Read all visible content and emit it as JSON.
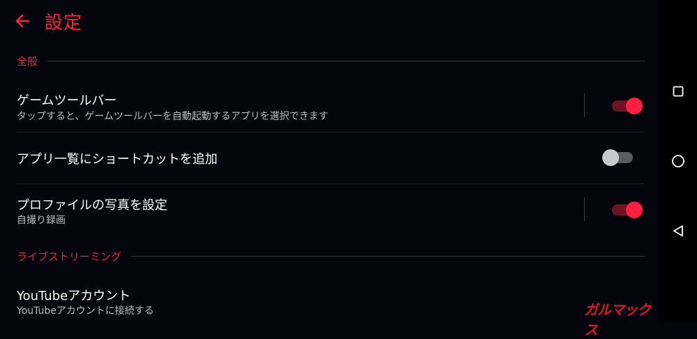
{
  "appbar": {
    "title": "設定",
    "back_icon": "arrow-left-icon"
  },
  "accent_color": "#ff1e3c",
  "sections": {
    "general": {
      "label": "全般"
    },
    "live": {
      "label": "ライブストリーミング"
    }
  },
  "settings": {
    "game_toolbar": {
      "title": "ゲームツールバー",
      "subtitle": "タップすると、ゲームツールバーを自動起動するアプリを選択できます",
      "enabled": true
    },
    "shortcut": {
      "title": "アプリ一覧にショートカットを追加",
      "enabled": false
    },
    "profile_photo": {
      "title": "プロファイルの写真を設定",
      "subtitle": "自撮り録画",
      "enabled": true
    },
    "youtube": {
      "title": "YouTubeアカウント",
      "subtitle": "YouTubeアカウントに接続する"
    }
  },
  "navbar": {
    "recents_icon": "square-icon",
    "home_icon": "circle-icon",
    "back_icon": "triangle-back-icon"
  },
  "watermark": "ガルマックス"
}
